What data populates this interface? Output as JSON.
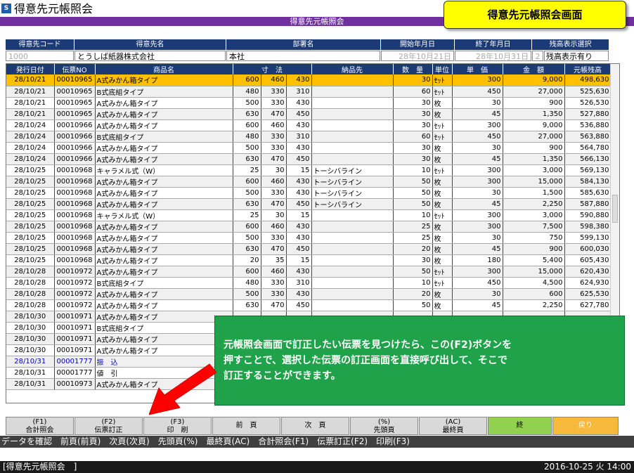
{
  "window": {
    "title": "得意先元帳照会",
    "subtitle": "得意先元帳照会",
    "icon": "app-icon"
  },
  "callout_top": "得意先元帳照会画面",
  "filter": {
    "headers": [
      "得意先コード",
      "得意先名",
      "部署名",
      "開始年月日",
      "終了年月日",
      "残高表示選択"
    ],
    "customer_code": "1000",
    "customer_name": "とうしば紙器株式会社",
    "department": "本社",
    "start_date": "28年10月21日",
    "end_date": "28年10月31日",
    "balance_option_num": "2",
    "balance_option": "残高表示有り"
  },
  "table": {
    "columns": [
      "発行日付",
      "伝票NO",
      "商品名",
      "寸　法",
      "",
      "",
      "納品先",
      "数　量",
      "単位",
      "単　価",
      "金　額",
      "元帳残高"
    ],
    "rows": [
      [
        "28/10/21",
        "00010965",
        "A式みかん箱タイプ",
        "600",
        "460",
        "430",
        "",
        "30",
        "ｾｯﾄ",
        "300",
        "9,000",
        "498,630"
      ],
      [
        "28/10/21",
        "00010965",
        "B式底組タイプ",
        "480",
        "330",
        "310",
        "",
        "60",
        "ｾｯﾄ",
        "450",
        "27,000",
        "525,630"
      ],
      [
        "28/10/21",
        "00010965",
        "A式みかん箱タイプ",
        "500",
        "330",
        "430",
        "",
        "30",
        "枚",
        "30",
        "900",
        "526,530"
      ],
      [
        "28/10/21",
        "00010965",
        "A式みかん箱タイプ",
        "630",
        "470",
        "450",
        "",
        "30",
        "枚",
        "45",
        "1,350",
        "527,880"
      ],
      [
        "28/10/24",
        "00010966",
        "A式みかん箱タイプ",
        "600",
        "460",
        "430",
        "",
        "30",
        "ｾｯﾄ",
        "300",
        "9,000",
        "536,880"
      ],
      [
        "28/10/24",
        "00010966",
        "B式底組タイプ",
        "480",
        "330",
        "310",
        "",
        "60",
        "ｾｯﾄ",
        "450",
        "27,000",
        "563,880"
      ],
      [
        "28/10/24",
        "00010966",
        "A式みかん箱タイプ",
        "500",
        "330",
        "430",
        "",
        "30",
        "枚",
        "30",
        "900",
        "564,780"
      ],
      [
        "28/10/24",
        "00010966",
        "A式みかん箱タイプ",
        "630",
        "470",
        "450",
        "",
        "30",
        "枚",
        "45",
        "1,350",
        "566,130"
      ],
      [
        "28/10/25",
        "00010968",
        "キャラメル式（W）",
        "25",
        "30",
        "15",
        "トーシバライン",
        "10",
        "ｾｯﾄ",
        "300",
        "3,000",
        "569,130"
      ],
      [
        "28/10/25",
        "00010968",
        "A式みかん箱タイプ",
        "600",
        "460",
        "430",
        "トーシバライン",
        "50",
        "枚",
        "300",
        "15,000",
        "584,130"
      ],
      [
        "28/10/25",
        "00010968",
        "A式みかん箱タイプ",
        "500",
        "330",
        "430",
        "トーシバライン",
        "50",
        "枚",
        "30",
        "1,500",
        "585,630"
      ],
      [
        "28/10/25",
        "00010968",
        "A式みかん箱タイプ",
        "630",
        "470",
        "450",
        "トーシバライン",
        "50",
        "枚",
        "45",
        "2,250",
        "587,880"
      ],
      [
        "28/10/25",
        "00010968",
        "キャラメル式（W）",
        "25",
        "30",
        "15",
        "",
        "10",
        "ｾｯﾄ",
        "300",
        "3,000",
        "590,880"
      ],
      [
        "28/10/25",
        "00010968",
        "A式みかん箱タイプ",
        "600",
        "460",
        "430",
        "",
        "25",
        "枚",
        "300",
        "7,500",
        "598,380"
      ],
      [
        "28/10/25",
        "00010968",
        "A式みかん箱タイプ",
        "500",
        "330",
        "430",
        "",
        "25",
        "枚",
        "30",
        "750",
        "599,130"
      ],
      [
        "28/10/25",
        "00010968",
        "A式みかん箱タイプ",
        "630",
        "470",
        "450",
        "",
        "20",
        "枚",
        "45",
        "900",
        "600,030"
      ],
      [
        "28/10/25",
        "00010968",
        "A式みかん箱タイプ",
        "20",
        "35",
        "15",
        "",
        "30",
        "枚",
        "180",
        "5,400",
        "605,430"
      ],
      [
        "28/10/28",
        "00010972",
        "A式みかん箱タイプ",
        "600",
        "460",
        "430",
        "",
        "50",
        "ｾｯﾄ",
        "300",
        "15,000",
        "620,430"
      ],
      [
        "28/10/28",
        "00010972",
        "B式底組タイプ",
        "480",
        "330",
        "310",
        "",
        "10",
        "ｾｯﾄ",
        "450",
        "4,500",
        "624,930"
      ],
      [
        "28/10/28",
        "00010972",
        "A式みかん箱タイプ",
        "500",
        "330",
        "430",
        "",
        "20",
        "枚",
        "30",
        "600",
        "625,530"
      ],
      [
        "28/10/28",
        "00010972",
        "A式みかん箱タイプ",
        "630",
        "470",
        "450",
        "",
        "50",
        "枚",
        "45",
        "2,250",
        "627,780"
      ],
      [
        "28/10/30",
        "00010971",
        "A式みかん箱タイプ",
        "",
        "",
        "",
        "",
        "",
        "",
        "",
        "",
        ""
      ],
      [
        "28/10/30",
        "00010971",
        "B式底組タイプ",
        "",
        "",
        "",
        "",
        "",
        "",
        "",
        "",
        ""
      ],
      [
        "28/10/30",
        "00010971",
        "A式みかん箱タイプ",
        "",
        "",
        "",
        "",
        "",
        "",
        "",
        "",
        ""
      ],
      [
        "28/10/30",
        "00010971",
        "A式みかん箱タイプ",
        "",
        "",
        "",
        "",
        "",
        "",
        "",
        "",
        ""
      ],
      [
        "28/10/31",
        "00001777",
        "振　込",
        "",
        "",
        "",
        "",
        "",
        "",
        "",
        "",
        ""
      ],
      [
        "28/10/31",
        "00001777",
        "値　引",
        "",
        "",
        "",
        "",
        "",
        "",
        "",
        "",
        ""
      ],
      [
        "28/10/31",
        "00010973",
        "A式みかん箱タイプ",
        "",
        "",
        "",
        "",
        "",
        "",
        "",
        "",
        ""
      ]
    ]
  },
  "overlay_text": [
    "元帳照会画面で訂正したい伝票を見つけたら、この(F2)ボタンを",
    "押すことで、選択した伝票の訂正画面を直接呼び出して、そこで",
    "訂正することができます。"
  ],
  "fkeys": [
    {
      "line1": "(F1)",
      "line2": "合計照会"
    },
    {
      "line1": "(F2)",
      "line2": "伝票訂正"
    },
    {
      "line1": "(F3)",
      "line2": "印　刷"
    },
    {
      "line1": "",
      "line2": "前　頁"
    },
    {
      "line1": "",
      "line2": "次　頁"
    },
    {
      "line1": "(%)",
      "line2": "先頭頁"
    },
    {
      "line1": "(AC)",
      "line2": "最終頁"
    },
    {
      "line1": "",
      "line2": "終"
    },
    {
      "line1": "",
      "line2": "戻り"
    }
  ],
  "help_text": "データを確認　前頁(前頁)　次頁(次頁)　先頭頁(%)　最終頁(AC)　合計照会(F1)　伝票訂正(F2)　印刷(F3)",
  "status": {
    "left": "[得意先元帳照会　]",
    "right": "2016-10-25 火 14:00"
  },
  "colors": {
    "header_bg": "#1c3a75",
    "selected_row": "#ffc000",
    "overlay_bg": "#1fa24a",
    "callout": "#ffff00",
    "arrow": "#ff0000"
  }
}
